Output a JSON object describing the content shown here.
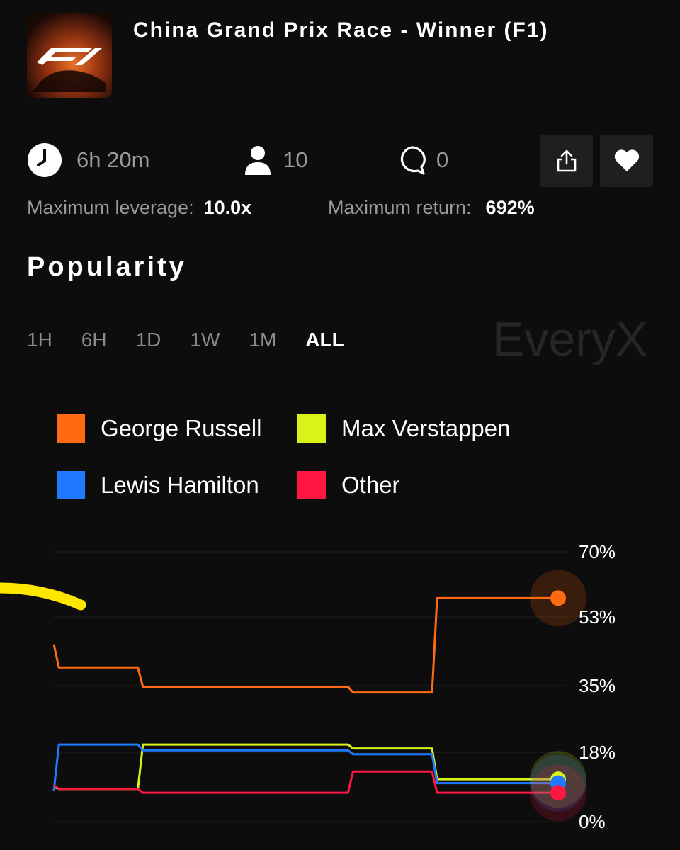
{
  "header": {
    "title": "China Grand Prix Race - Winner (F1)",
    "thumbnail_logo": "F1"
  },
  "stats": {
    "time_left": "6h 20m",
    "participants": "10",
    "comments": "0",
    "icons": [
      "clock-icon",
      "user-icon",
      "comment-icon",
      "share-icon",
      "heart-icon"
    ]
  },
  "meta": {
    "leverage_label": "Maximum leverage:",
    "leverage_value": "10.0x",
    "return_label": "Maximum return:",
    "return_value": "692%"
  },
  "popularity": {
    "title": "Popularity",
    "ranges": [
      "1H",
      "6H",
      "1D",
      "1W",
      "1M",
      "ALL"
    ],
    "active_range": "ALL",
    "watermark": "EveryX"
  },
  "chart_data": {
    "type": "line",
    "y_ticks": [
      "70%",
      "53%",
      "35%",
      "18%",
      "0%"
    ],
    "ylim": [
      0,
      70
    ],
    "x": [
      0,
      1,
      2,
      3,
      4,
      5,
      6,
      7,
      8,
      9,
      10,
      11,
      12
    ],
    "series": [
      {
        "name": "George Russell",
        "color": "#ff6a13",
        "values": [
          46,
          40,
          40,
          35,
          35,
          35,
          35,
          35,
          33.5,
          33.5,
          58,
          58,
          58
        ]
      },
      {
        "name": "Max Verstappen",
        "color": "#d8f21a",
        "values": [
          9,
          8.5,
          8.5,
          20,
          20,
          20,
          20,
          20,
          19,
          19,
          11,
          11,
          11
        ]
      },
      {
        "name": "Lewis Hamilton",
        "color": "#1f7aff",
        "values": [
          8,
          20,
          20,
          18.5,
          18.5,
          18.5,
          18.5,
          18.5,
          17.5,
          17.5,
          10,
          10,
          10
        ]
      },
      {
        "name": "Other",
        "color": "#ff1744",
        "values": [
          9.5,
          8.5,
          8.5,
          7.5,
          7.5,
          7.5,
          7.5,
          7.5,
          13,
          13,
          7.5,
          7.5,
          7.5
        ]
      }
    ],
    "grid": true,
    "legend_position": "top"
  }
}
